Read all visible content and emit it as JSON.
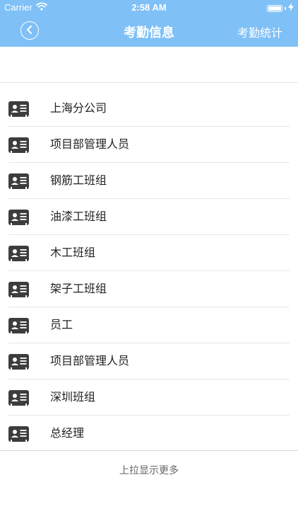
{
  "status_bar": {
    "carrier": "Carrier",
    "time": "2:58 AM",
    "battery_level_percent": 100
  },
  "navbar": {
    "title": "考勤信息",
    "right_action": "考勤统计",
    "back_icon": "chevron-left-icon"
  },
  "list": {
    "item_icon": "contact-card-icon",
    "items": [
      {
        "label": "上海分公司"
      },
      {
        "label": "项目部管理人员"
      },
      {
        "label": "钢筋工班组"
      },
      {
        "label": "油漆工班组"
      },
      {
        "label": "木工班组"
      },
      {
        "label": "架子工班组"
      },
      {
        "label": "员工"
      },
      {
        "label": "项目部管理人员"
      },
      {
        "label": "深圳班组"
      },
      {
        "label": "总经理"
      }
    ]
  },
  "footer": {
    "load_more": "上拉显示更多"
  },
  "colors": {
    "header_bg": "#7fc0f7",
    "icon_color": "#3d3d3d",
    "text_color": "#222222",
    "divider": "#e6e6e6"
  }
}
